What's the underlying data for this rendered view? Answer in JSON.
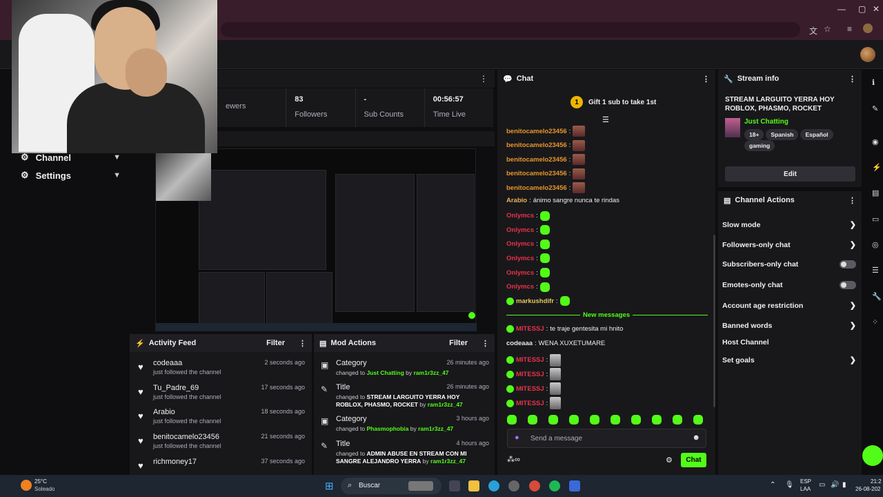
{
  "stats": [
    {
      "value": "",
      "label": "ewers"
    },
    {
      "value": "83",
      "label": "Followers"
    },
    {
      "value": "-",
      "label": "Sub Counts"
    },
    {
      "value": "00:56:57",
      "label": "Time Live"
    }
  ],
  "sidebar": {
    "items": [
      {
        "label": "Channel"
      },
      {
        "label": "Settings"
      }
    ]
  },
  "activity": {
    "title": "Activity Feed",
    "filter": "Filter",
    "items": [
      {
        "name": "codeaaa",
        "sub": "just followed the channel",
        "time": "2 seconds ago"
      },
      {
        "name": "Tu_Padre_69",
        "sub": "just followed the channel",
        "time": "17 seconds ago"
      },
      {
        "name": "Arabio",
        "sub": "just followed the channel",
        "time": "18 seconds ago"
      },
      {
        "name": "benitocamelo23456",
        "sub": "just followed the channel",
        "time": "21 seconds ago"
      },
      {
        "name": "richmoney17",
        "sub": "",
        "time": "37 seconds ago"
      }
    ]
  },
  "mod": {
    "title": "Mod Actions",
    "filter": "Filter",
    "items": [
      {
        "title": "Category",
        "prefix": "changed to",
        "value": "Just Chatting",
        "by": "by",
        "user": "ram1r3zz_47",
        "time": "26 minutes ago"
      },
      {
        "title": "Title",
        "prefix": "changed to",
        "value": "STREAM LARGUITO YERRA HOY ROBLOX, PHASMO, ROCKET",
        "by": "by",
        "user": "ram1r3zz_47",
        "time": "26 minutes ago"
      },
      {
        "title": "Category",
        "prefix": "changed to",
        "value": "Phasmophobia",
        "by": "by",
        "user": "ram1r3zz_47",
        "time": "3 hours ago"
      },
      {
        "title": "Title",
        "prefix": "changed to",
        "value": "ADMIN ABUSE EN STREAM CON MI SANGRE ALEJANDRO YERRA",
        "by": "by",
        "user": "ram1r3zz_47",
        "time": "4 hours ago"
      }
    ]
  },
  "chat": {
    "title": "Chat",
    "gift": "Gift 1 sub to take 1st",
    "gift_rank": "1",
    "new_messages": "New messages",
    "placeholder": "Send a message",
    "send": "Chat",
    "messages": [
      {
        "user": "benitocamelo23456",
        "color": "#e8962a",
        "text": "",
        "badge": false,
        "media": "thumb"
      },
      {
        "user": "benitocamelo23456",
        "color": "#e8962a",
        "text": "",
        "badge": false,
        "media": "thumb"
      },
      {
        "user": "benitocamelo23456",
        "color": "#e8962a",
        "text": "",
        "badge": false,
        "media": "thumb"
      },
      {
        "user": "benitocamelo23456",
        "color": "#e8962a",
        "text": "",
        "badge": false,
        "media": "thumb"
      },
      {
        "user": "benitocamelo23456",
        "color": "#e8962a",
        "text": "",
        "badge": false,
        "media": "thumb"
      },
      {
        "user": "Arabio",
        "color": "#e8b35a",
        "text": "ánimo sangre nunca te rindas",
        "badge": false,
        "media": ""
      },
      {
        "user": "Onlymcs",
        "color": "#e8324a",
        "text": "",
        "badge": false,
        "media": "emote"
      },
      {
        "user": "Onlymcs",
        "color": "#e8324a",
        "text": "",
        "badge": false,
        "media": "emote"
      },
      {
        "user": "Onlymcs",
        "color": "#e8324a",
        "text": "",
        "badge": false,
        "media": "emote"
      },
      {
        "user": "Onlymcs",
        "color": "#e8324a",
        "text": "",
        "badge": false,
        "media": "emote"
      },
      {
        "user": "Onlymcs",
        "color": "#e8324a",
        "text": "",
        "badge": false,
        "media": "emote"
      },
      {
        "user": "Onlymcs",
        "color": "#e8324a",
        "text": "",
        "badge": false,
        "media": "emote"
      },
      {
        "user": "markushdifr",
        "color": "#e8c85a",
        "text": "",
        "badge": true,
        "media": "emote"
      }
    ],
    "new_list": [
      {
        "user": "MITESSJ",
        "color": "#e8324a",
        "text": "te traje gentesita mi hnito",
        "badge": true,
        "media": ""
      },
      {
        "user": "codeaaa",
        "color": "#e8e8e8",
        "text": "WENA XUXETUMARE",
        "badge": false,
        "media": ""
      },
      {
        "user": "MITESSJ",
        "color": "#e8324a",
        "text": "",
        "badge": true,
        "media": "thumb2"
      },
      {
        "user": "MITESSJ",
        "color": "#e8324a",
        "text": "",
        "badge": true,
        "media": "thumb2"
      },
      {
        "user": "MITESSJ",
        "color": "#e8324a",
        "text": "",
        "badge": true,
        "media": "thumb2"
      },
      {
        "user": "MITESSJ",
        "color": "#e8324a",
        "text": "",
        "badge": true,
        "media": "thumb2"
      }
    ]
  },
  "streaminfo": {
    "title": "Stream info",
    "stream_title": "STREAM LARGUITO YERRA HOY ROBLOX, PHASMO, ROCKET",
    "category": "Just Chatting",
    "tags": [
      "18+",
      "Spanish",
      "Español",
      "gaming"
    ],
    "edit": "Edit"
  },
  "actions": {
    "title": "Channel Actions",
    "items": [
      {
        "label": "Slow mode",
        "kind": "chevron"
      },
      {
        "label": "Followers-only chat",
        "kind": "chevron"
      },
      {
        "label": "Subscribers-only chat",
        "kind": "toggle"
      },
      {
        "label": "Emotes-only chat",
        "kind": "toggle"
      },
      {
        "label": "Account age restriction",
        "kind": "chevron"
      },
      {
        "label": "Banned words",
        "kind": "chevron"
      },
      {
        "label": "Host Channel",
        "kind": "none"
      },
      {
        "label": "Set goals",
        "kind": "chevron"
      }
    ]
  },
  "taskbar": {
    "weather_temp": "25°C",
    "weather_desc": "Soleado",
    "search": "Buscar",
    "lang1": "ESP",
    "lang2": "LAA",
    "time": "21:2",
    "date": "26-08-202"
  },
  "colors": {
    "accent": "#53fc18",
    "panel": "#18181b",
    "bg": "#0e0e10"
  }
}
